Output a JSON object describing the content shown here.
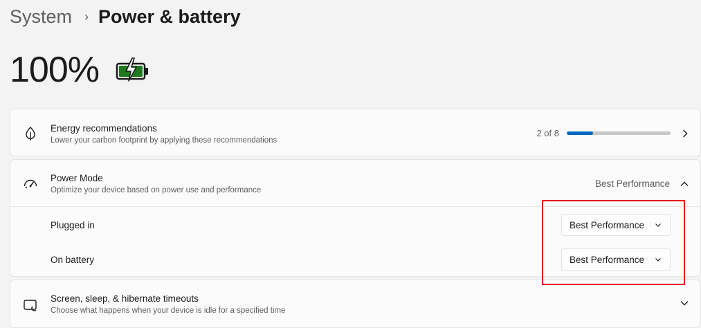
{
  "breadcrumb": {
    "parent": "System",
    "separator": "›",
    "current": "Power & battery"
  },
  "battery": {
    "percent_label": "100%",
    "icon": "battery-charging-icon",
    "fill_color": "#1f7a1f"
  },
  "energy": {
    "icon": "leaf-icon",
    "title": "Energy recommendations",
    "description": "Lower your carbon footprint by applying these recommendations",
    "progress_text": "2 of 8",
    "progress_fraction": 0.25,
    "accent": "#0067c0"
  },
  "power_mode": {
    "icon": "speedometer-icon",
    "title": "Power Mode",
    "description": "Optimize your device based on power use and performance",
    "current_value": "Best Performance",
    "plugged_in": {
      "label": "Plugged in",
      "selected": "Best Performance"
    },
    "on_battery": {
      "label": "On battery",
      "selected": "Best Performance"
    }
  },
  "screen_sleep": {
    "icon": "screen-sleep-icon",
    "title": "Screen, sleep, & hibernate timeouts",
    "description": "Choose what happens when your device is idle for a specified time"
  },
  "annotation": {
    "color": "#e2191b"
  }
}
